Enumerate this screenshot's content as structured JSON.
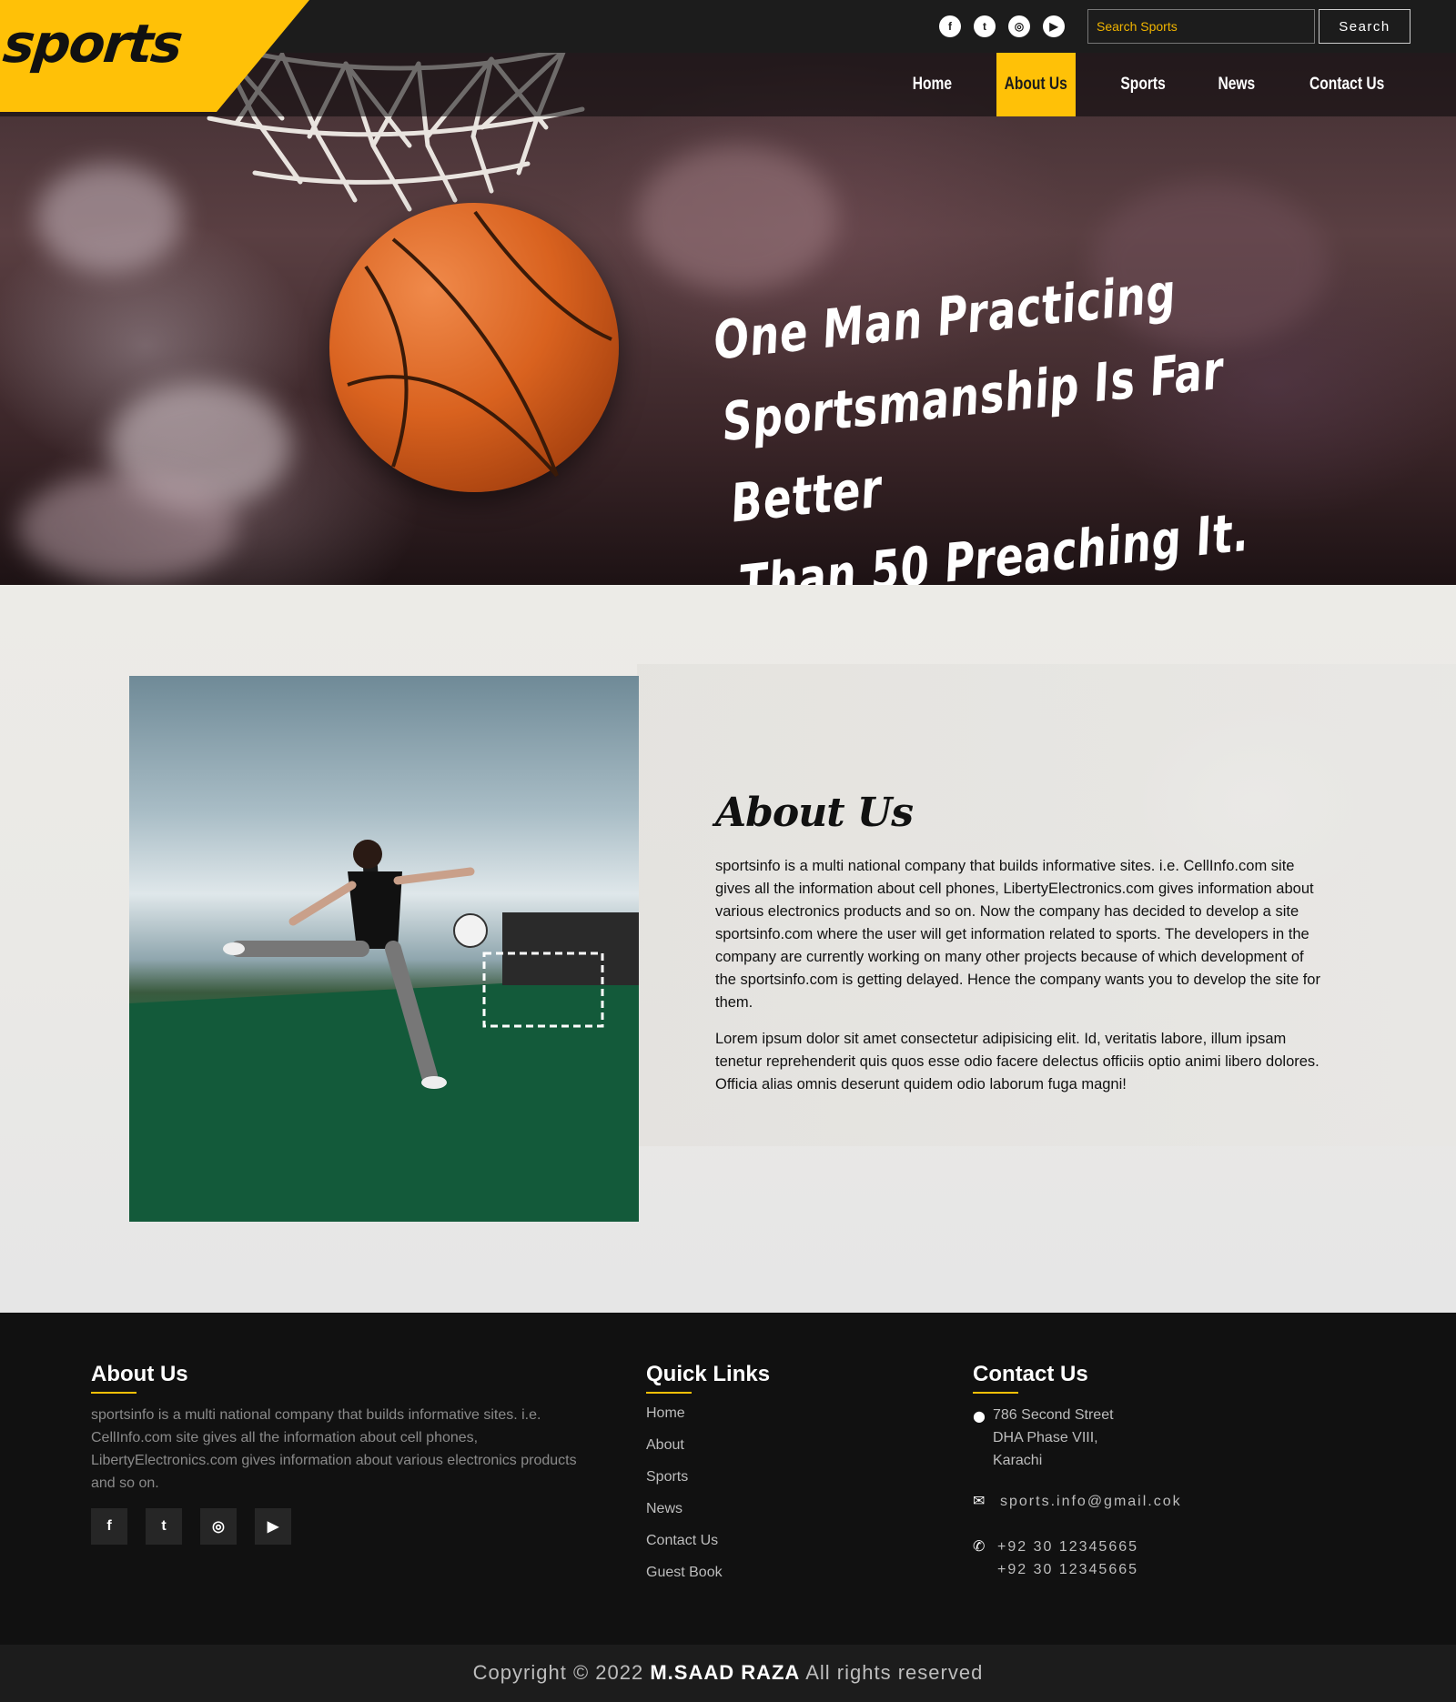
{
  "brand": {
    "logo_text": "sports",
    "accent": "#ffc107",
    "dark": "#1c1c1c"
  },
  "topbar": {
    "social_icons": [
      "facebook-icon",
      "twitter-icon",
      "instagram-icon",
      "youtube-icon"
    ],
    "search_placeholder": "Search Sports",
    "search_button": "Search"
  },
  "nav": {
    "items": [
      {
        "label": "Home",
        "active": false
      },
      {
        "label": "About Us",
        "active": true
      },
      {
        "label": "Sports",
        "active": false
      },
      {
        "label": "News",
        "active": false
      },
      {
        "label": "Contact Us",
        "active": false
      }
    ]
  },
  "hero": {
    "quote_line1": "One Man Practicing",
    "quote_line2": "Sportsmanship Is Far Better",
    "quote_line3": "Than 50 Preaching It."
  },
  "about": {
    "title": "About Us",
    "paragraph1": "sportsinfo is a multi national company that builds informative sites. i.e. CellInfo.com site gives all the information about cell phones, LibertyElectronics.com gives information about various electronics products and so on. Now the company has decided to develop a site sportsinfo.com where the user will get information related to sports. The developers in the company are currently working on many other projects because of which development of the sportsinfo.com is getting delayed. Hence the company wants you to develop the site for them.",
    "paragraph2": "Lorem ipsum dolor sit amet consectetur adipisicing elit. Id, veritatis labore, illum ipsam tenetur reprehenderit quis quos esse odio facere delectus officiis optio animi libero dolores. Officia alias omnis deserunt quidem odio laborum fuga magni!"
  },
  "footer": {
    "about": {
      "heading": "About Us",
      "text": "sportsinfo is a multi national company that builds informative sites. i.e. CellInfo.com site gives all the information about cell phones, LibertyElectronics.com gives information about various electronics products and so on.",
      "social_icons": [
        "facebook-icon",
        "twitter-icon",
        "instagram-icon",
        "youtube-icon"
      ]
    },
    "quick_links": {
      "heading": "Quick Links",
      "links": [
        "Home",
        "About",
        "Sports",
        "News",
        "Contact Us",
        "Guest Book"
      ]
    },
    "contact": {
      "heading": "Contact Us",
      "address_line1": "786 Second Street",
      "address_line2": "DHA Phase VIII,",
      "address_line3": "Karachi",
      "email": "sports.info@gmail.cok",
      "phone1": "+92 30 12345665",
      "phone2": "+92 30 12345665"
    }
  },
  "copyright": {
    "prefix": "Copyright © 2022",
    "name": "M.SAAD RAZA",
    "suffix": "All rights reserved"
  }
}
